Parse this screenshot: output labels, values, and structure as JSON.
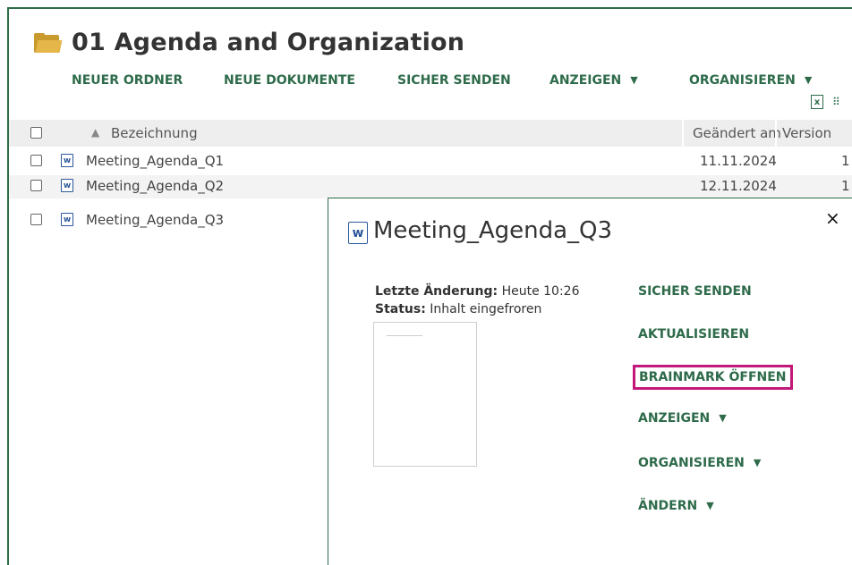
{
  "header": {
    "title": "01 Agenda and Organization",
    "folder_icon": "folder-icon"
  },
  "toolbar": {
    "new_folder": "NEUER ORDNER",
    "new_documents": "NEUE DOKUMENTE",
    "send_secure": "SICHER SENDEN",
    "view": "ANZEIGEN",
    "organize": "ORGANISIEREN",
    "caret": "▼",
    "export_icon": "excel-icon",
    "excel_glyph": "x",
    "grid_icon": "grid-icon",
    "grid_glyph": "⠿"
  },
  "table": {
    "sort_glyph": "▲",
    "columns": {
      "name": "Bezeichnung",
      "changed": "Geändert am",
      "version": "Version"
    },
    "rows": [
      {
        "name": "Meeting_Agenda_Q1",
        "changed": "11.11.2024",
        "version": "1"
      },
      {
        "name": "Meeting_Agenda_Q2",
        "changed": "12.11.2024",
        "version": "1"
      },
      {
        "name": "Meeting_Agenda_Q3",
        "changed": "",
        "version": ""
      }
    ],
    "doc_glyph": "w"
  },
  "popup": {
    "title": "Meeting_Agenda_Q3",
    "close_glyph": "×",
    "last_change_label": "Letzte Änderung:",
    "last_change_value": "Heute 10:26",
    "status_label": "Status:",
    "status_value": "Inhalt eingefroren",
    "actions": {
      "send_secure": "SICHER SENDEN",
      "update": "AKTUALISIEREN",
      "open_brainmark": "BRAINMARK ÖFFNEN",
      "view": "ANZEIGEN",
      "organize": "ORGANISIEREN",
      "change": "ÄNDERN"
    },
    "highlight_color": "#c2187a"
  },
  "colors": {
    "accent_green": "#2e6b4a",
    "word_blue": "#2b579a",
    "folder_yellow": "#e5b64a"
  }
}
